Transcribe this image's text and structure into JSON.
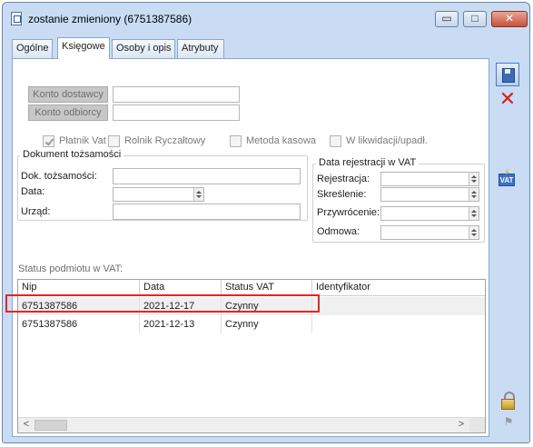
{
  "window": {
    "title": "zostanie zmieniony (6751387586)",
    "minimize_glyph": "▭",
    "maximize_glyph": "□",
    "close_glyph": "✕"
  },
  "tabs": [
    {
      "label": "Ogólne",
      "active": false
    },
    {
      "label": "Księgowe",
      "active": true
    },
    {
      "label": "Osoby i opis",
      "active": false
    },
    {
      "label": "Atrybuty",
      "active": false
    }
  ],
  "accounts": {
    "supplier_label": "Konto dostawcy",
    "supplier_value": "",
    "customer_label": "Konto odbiorcy",
    "customer_value": ""
  },
  "flags": {
    "vat_payer": {
      "label": "Płatnik Vat",
      "checked": true
    },
    "flat_farmer": {
      "label": "Rolnik Ryczałtowy",
      "checked": false
    },
    "cash_method": {
      "label": "Metoda kasowa",
      "checked": false
    },
    "liquidation": {
      "label": "W likwidacji/upadł.",
      "checked": false
    }
  },
  "identity_doc": {
    "group_title": "Dokument tożsamości",
    "doc_label": "Dok. tożsamości:",
    "doc_value": "",
    "date_label": "Data:",
    "date_value": "",
    "office_label": "Urząd:",
    "office_value": ""
  },
  "vat_registration": {
    "group_title": "Data rejestracji w VAT",
    "registration_label": "Rejestracja:",
    "registration_value": "",
    "removal_label": "Skreślenie:",
    "removal_value": "",
    "restoration_label": "Przywrócenie:",
    "restoration_value": "",
    "refusal_label": "Odmowa:",
    "refusal_value": ""
  },
  "vat_status": {
    "section_label": "Status podmiotu w VAT:",
    "columns": [
      "Nip",
      "Data",
      "Status VAT",
      "Identyfikator"
    ],
    "rows": [
      {
        "nip": "6751387586",
        "date": "2021-12-17",
        "status": "Czynny",
        "identifier": "",
        "selected": true
      },
      {
        "nip": "6751387586",
        "date": "2021-12-13",
        "status": "Czynny",
        "identifier": "",
        "selected": false
      }
    ],
    "scroll_left": "<",
    "scroll_right": ">"
  },
  "sidebar": {
    "cancel_glyph": "✕",
    "vat_text": "VAT",
    "vat_bolt": "⚡",
    "flag_glyph": "⚑"
  },
  "colors": {
    "window_bg": "#c9dcf4",
    "highlight_border": "#e0262b",
    "cancel_red": "#d42020"
  }
}
